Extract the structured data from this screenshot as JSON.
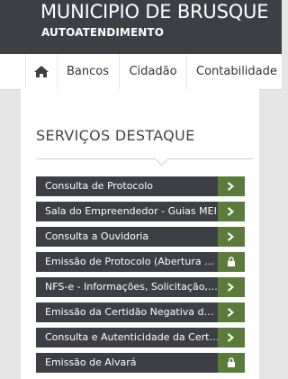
{
  "header": {
    "title": "MUNICIPIO DE BRUSQUE",
    "subtitle": "AUTOATENDIMENTO"
  },
  "nav": {
    "home_icon": "home-icon",
    "items": [
      "Bancos",
      "Cidadão",
      "Contabilidade"
    ]
  },
  "panel": {
    "title": "SERVIÇOS DESTAQUE"
  },
  "services": [
    {
      "label": "Consulta de Protocolo",
      "action": "chevron-right-icon"
    },
    {
      "label": "Sala do Empreendedor - Guias MEI",
      "action": "chevron-right-icon"
    },
    {
      "label": "Consulta a Ouvidoria",
      "action": "chevron-right-icon"
    },
    {
      "label": "Emissão de Protocolo (Abertura de Processo)",
      "action": "lock-icon"
    },
    {
      "label": "NFS-e - Informações, Solicitação, Consulta",
      "action": "chevron-right-icon"
    },
    {
      "label": "Emissão da Certidão Negativa de Débitos",
      "action": "chevron-right-icon"
    },
    {
      "label": "Consulta e Autenticidade da Certidão",
      "action": "chevron-right-icon"
    },
    {
      "label": "Emissão de Alvará",
      "action": "lock-icon"
    }
  ],
  "colors": {
    "header_bg": "#3e3f45",
    "service_bg": "#3e3f45",
    "action_green": "#5b7b3a",
    "page_bg": "#e5e5e5"
  }
}
